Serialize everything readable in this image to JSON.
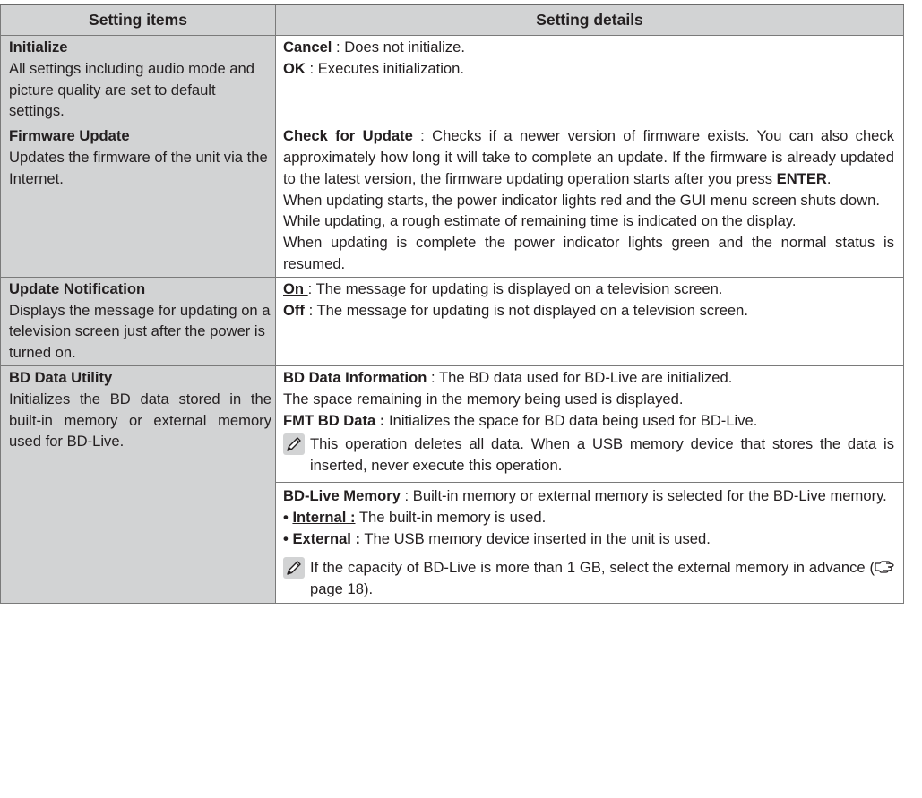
{
  "table": {
    "headers": [
      "Setting items",
      "Setting details"
    ],
    "rows": {
      "initialize": {
        "title": "Initialize",
        "description": "All settings including audio mode and picture quality are set to default settings.",
        "details": [
          {
            "label": "Cancel",
            "sep": " : ",
            "text": "Does not initialize."
          },
          {
            "label": "OK",
            "sep": " : ",
            "text": "Executes initialization."
          }
        ]
      },
      "firmware": {
        "title": "Firmware Update",
        "description": "Updates the firmware of the unit via the Internet.",
        "check_label": "Check for Update",
        "check_sep": " : ",
        "check_text": "Checks if a newer version of firmware exists. You can also check approximately how long it will take to complete an update. If the firmware is already updated to the latest version, the firmware updating operation starts after you press ",
        "check_enter": "ENTER",
        "check_end": ".",
        "para2": "When updating starts, the power indicator lights red and the GUI menu screen shuts down.",
        "para3": "While updating, a rough estimate of remaining time is indicated on the display.",
        "para4": "When updating is complete the power indicator lights green and the normal status is resumed."
      },
      "notification": {
        "title": "Update Notification",
        "description": "Displays the message for updating on a television screen just after the power is turned on.",
        "details": [
          {
            "label": "On ",
            "sep": ": ",
            "text": "The message for updating is displayed on a television screen."
          },
          {
            "label": "Off",
            "sep": " : ",
            "text": "The message for updating is not displayed on a television screen."
          }
        ]
      },
      "bd_data": {
        "title": "BD Data Utility",
        "description": "Initializes the BD data stored in the built-in memory or external memory used for BD-Live.",
        "info_label": "BD Data Information",
        "info_sep": " : ",
        "info_text": "The BD data used for BD-Live are initialized.",
        "info_line2": "The space remaining in the memory being used is displayed.",
        "fmt_label": "FMT BD Data :",
        "fmt_text": " Initializes the space for BD data being used for BD-Live.",
        "note1": "This operation deletes all data. When a USB memory device that stores the data is inserted, never execute this operation.",
        "memory_label": "BD-Live Memory",
        "memory_sep": " : ",
        "memory_text": "Built-in memory or external memory is selected for the BD-Live memory.",
        "bullet_char": "•",
        "internal_label": "Internal :",
        "internal_text": " The built-in memory is used.",
        "external_label": "External :",
        "external_text": " The USB memory device inserted in the unit is used.",
        "note2_text": "If the capacity of BD-Live is more than 1 GB, select the external memory in advance (",
        "note2_ref_icon": "pointing-hand-icon",
        "note2_ref": "page 18",
        "note2_end": ")."
      }
    }
  },
  "colors": {
    "header_bg": "#d2d3d4",
    "item_bg": "#d2d3d4",
    "border": "#7a7a7a",
    "text": "#231f20"
  }
}
